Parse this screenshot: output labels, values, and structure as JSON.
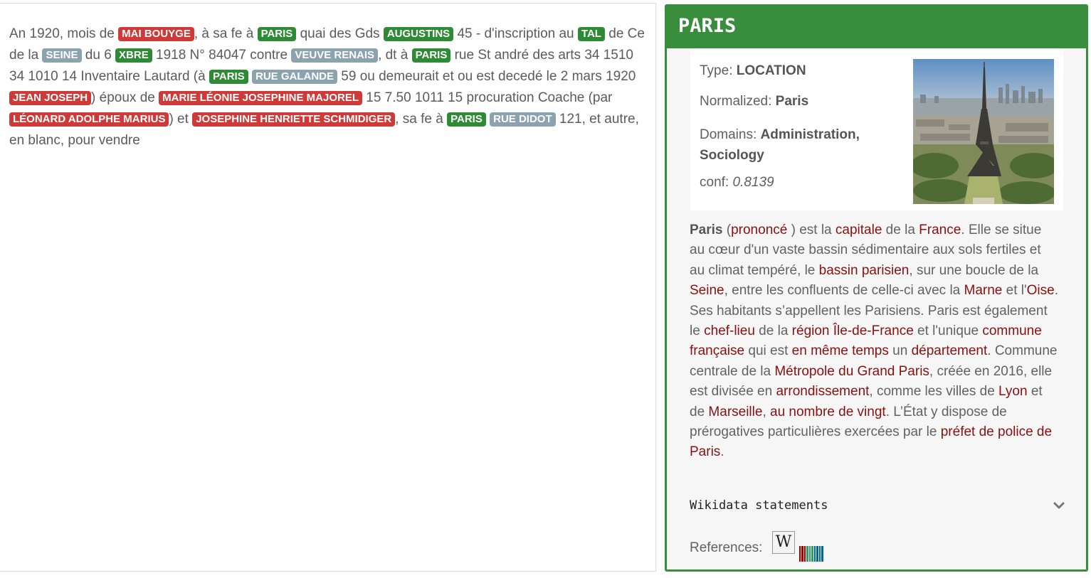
{
  "document": {
    "segments": [
      {
        "t": "text",
        "v": "An 1920, mois de "
      },
      {
        "t": "tag",
        "c": "red",
        "v": "MAI BOUYGE"
      },
      {
        "t": "text",
        "v": ", à sa fe à "
      },
      {
        "t": "tag",
        "c": "green",
        "v": "PARIS"
      },
      {
        "t": "text",
        "v": " quai des Gds "
      },
      {
        "t": "tag",
        "c": "green",
        "v": "AUGUSTINS"
      },
      {
        "t": "text",
        "v": " 45 - d'inscription au "
      },
      {
        "t": "tag",
        "c": "green",
        "v": "TAL"
      },
      {
        "t": "text",
        "v": " de Ce de la "
      },
      {
        "t": "tag",
        "c": "gray",
        "v": "SEINE"
      },
      {
        "t": "text",
        "v": " du 6 "
      },
      {
        "t": "tag",
        "c": "green",
        "v": "XBRE"
      },
      {
        "t": "text",
        "v": " 1918 N° 84047 contre "
      },
      {
        "t": "tag",
        "c": "gray",
        "v": "VEUVE RENAIS"
      },
      {
        "t": "text",
        "v": ", dt à "
      },
      {
        "t": "tag",
        "c": "green",
        "v": "PARIS"
      },
      {
        "t": "text",
        "v": " rue St andré des arts 34 1510 34 1010 14 Inventaire Lautard (à "
      },
      {
        "t": "tag",
        "c": "green",
        "v": "PARIS"
      },
      {
        "t": "text",
        "v": " "
      },
      {
        "t": "tag",
        "c": "gray",
        "v": "RUE GALANDE"
      },
      {
        "t": "text",
        "v": " 59 ou demeurait et ou est decedé le 2 mars 1920 "
      },
      {
        "t": "tag",
        "c": "red",
        "v": "JEAN JOSEPH"
      },
      {
        "t": "text",
        "v": ") époux de "
      },
      {
        "t": "tag",
        "c": "red",
        "v": "MARIE LÉONIE JOSEPHINE MAJOREL"
      },
      {
        "t": "text",
        "v": " 15 7.50 1011 15 procuration Coache (par "
      },
      {
        "t": "tag",
        "c": "red",
        "v": "LÉONARD ADOLPHE MARIUS"
      },
      {
        "t": "text",
        "v": ") et "
      },
      {
        "t": "tag",
        "c": "red",
        "v": "JOSEPHINE HENRIETTE SCHMIDIGER"
      },
      {
        "t": "text",
        "v": ", sa fe à "
      },
      {
        "t": "tag",
        "c": "green",
        "v": "PARIS"
      },
      {
        "t": "text",
        "v": " "
      },
      {
        "t": "tag",
        "c": "gray",
        "v": "RUE DIDOT"
      },
      {
        "t": "text",
        "v": " 121, et autre, en blanc, pour vendre"
      }
    ]
  },
  "entity": {
    "title": "PARIS",
    "type_label": "Type: ",
    "type_value": "LOCATION",
    "normalized_label": "Normalized: ",
    "normalized_value": "Paris",
    "domains_label": "Domains: ",
    "domains_line1": "Administration,",
    "domains_line2": "Sociology",
    "conf_label": "conf: ",
    "conf_value": "0.8139",
    "description": [
      {
        "t": "b",
        "v": "Paris"
      },
      {
        "t": "text",
        "v": " ("
      },
      {
        "t": "link",
        "v": "prononcé"
      },
      {
        "t": "text",
        "v": " ) est la "
      },
      {
        "t": "link",
        "v": "capitale"
      },
      {
        "t": "text",
        "v": " de la "
      },
      {
        "t": "link",
        "v": "France"
      },
      {
        "t": "text",
        "v": ". Elle se situe au cœur d'un vaste bassin sédimentaire aux sols fertiles et au climat tempéré, le "
      },
      {
        "t": "link",
        "v": "bassin parisien"
      },
      {
        "t": "text",
        "v": ", sur une boucle de la "
      },
      {
        "t": "link",
        "v": "Seine"
      },
      {
        "t": "text",
        "v": ", entre les confluents de celle-ci avec la "
      },
      {
        "t": "link",
        "v": "Marne"
      },
      {
        "t": "text",
        "v": " et l'"
      },
      {
        "t": "link",
        "v": "Oise"
      },
      {
        "t": "text",
        "v": ". Ses habitants s’appellent les Parisiens. Paris est également le "
      },
      {
        "t": "link",
        "v": "chef-lieu"
      },
      {
        "t": "text",
        "v": " de la "
      },
      {
        "t": "link",
        "v": "région Île-de-France"
      },
      {
        "t": "text",
        "v": " et l'unique "
      },
      {
        "t": "link",
        "v": "commune française"
      },
      {
        "t": "text",
        "v": " qui est "
      },
      {
        "t": "link",
        "v": "en même temps"
      },
      {
        "t": "text",
        "v": " un "
      },
      {
        "t": "link",
        "v": "département"
      },
      {
        "t": "text",
        "v": ". Commune centrale de la "
      },
      {
        "t": "link",
        "v": "Métropole du Grand Paris"
      },
      {
        "t": "text",
        "v": ", créée en 2016, elle est divisée en "
      },
      {
        "t": "link",
        "v": "arrondissement"
      },
      {
        "t": "text",
        "v": ", comme les villes de "
      },
      {
        "t": "link",
        "v": "Lyon"
      },
      {
        "t": "text",
        "v": " et de "
      },
      {
        "t": "link",
        "v": "Marseille"
      },
      {
        "t": "text",
        "v": ", "
      },
      {
        "t": "link",
        "v": "au nombre de vingt"
      },
      {
        "t": "text",
        "v": ". L’État y dispose de prérogatives particulières exercées par le "
      },
      {
        "t": "link",
        "v": "préfet de police de Paris"
      },
      {
        "t": "text",
        "v": "."
      }
    ],
    "wikidata_label": "Wikidata statements",
    "references_label": "References:",
    "wiki_glyph": "W",
    "colors": {
      "accent": "#388e3c",
      "link": "#8a1010",
      "tag_red": "#cd3a37",
      "tag_green": "#2e8a35",
      "tag_gray": "#8aa3ae"
    },
    "icons": [
      "chevron-down-icon",
      "wikipedia-icon",
      "wikidata-icon"
    ]
  }
}
